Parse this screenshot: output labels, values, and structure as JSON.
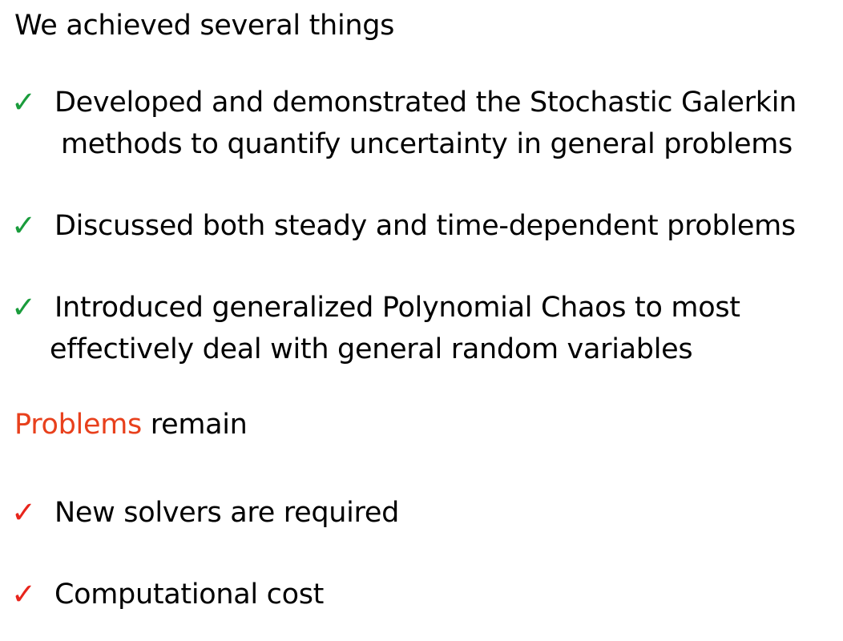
{
  "heading_achieved": "We achieved several things",
  "achievements": [
    {
      "icon": "green-checkmark-icon",
      "lines": [
        "Developed and demonstrated the Stochastic Galerkin",
        "methods to quantify uncertainty in general problems"
      ]
    },
    {
      "icon": "green-checkmark-icon",
      "lines": [
        "Discussed both steady and time-dependent problems"
      ]
    },
    {
      "icon": "green-checkmark-icon",
      "lines": [
        "Introduced generalized Polynomial Chaos to most",
        "effectively deal with general random variables"
      ]
    }
  ],
  "heading_problems": {
    "accent_word": "Problems",
    "rest": " remain"
  },
  "problems": [
    {
      "icon": "red-checkmark-icon",
      "lines": [
        "New solvers are required"
      ]
    },
    {
      "icon": "red-checkmark-icon",
      "lines": [
        "Computational cost"
      ]
    }
  ],
  "check_glyph": "✓",
  "colors": {
    "green_check": "#1a9c3c",
    "red_check": "#e8251c",
    "accent_text": "#e8401c",
    "text": "#000000",
    "background": "#ffffff"
  }
}
